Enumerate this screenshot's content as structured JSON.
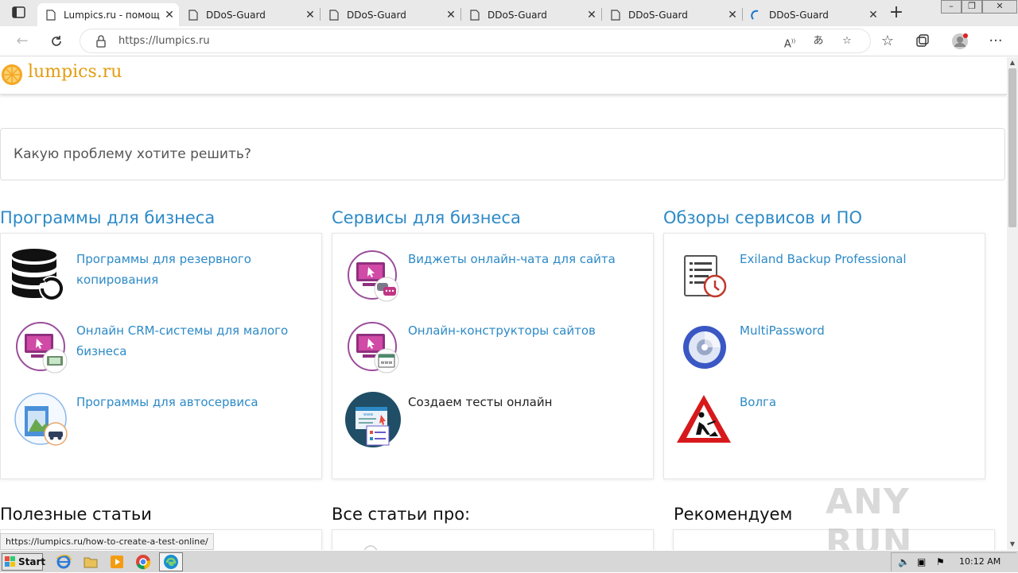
{
  "browser": {
    "tabs": [
      {
        "title": "Lumpics.ru - помощ",
        "active": true
      },
      {
        "title": "DDoS-Guard",
        "active": false
      },
      {
        "title": "DDoS-Guard",
        "active": false
      },
      {
        "title": "DDoS-Guard",
        "active": false
      },
      {
        "title": "DDoS-Guard",
        "active": false
      },
      {
        "title": "DDoS-Guard",
        "active": false,
        "loading": true
      }
    ],
    "url": "https://lumpics.ru",
    "status_url": "https://lumpics.ru/how-to-create-a-test-online/"
  },
  "site": {
    "logo_text": "lumpics.ru",
    "search_placeholder": "Какую проблему хотите решить?",
    "columns": [
      {
        "title": "Программы для бизнеса",
        "items": [
          {
            "label": "Программы для резервного копирования",
            "icon": "database-backup-icon"
          },
          {
            "label": "Онлайн CRM-системы для малого бизнеса",
            "icon": "crm-icon"
          },
          {
            "label": "Программы для автосервиса",
            "icon": "autoservice-icon"
          }
        ]
      },
      {
        "title": "Сервисы для бизнеса",
        "items": [
          {
            "label": "Виджеты онлайн-чата для сайта",
            "icon": "chat-widget-icon"
          },
          {
            "label": "Онлайн-конструкторы сайтов",
            "icon": "site-builder-icon"
          },
          {
            "label": "Создаем тесты онлайн",
            "icon": "online-test-icon"
          }
        ]
      },
      {
        "title": "Обзоры сервисов и ПО",
        "items": [
          {
            "label": "Exiland Backup Professional",
            "icon": "exiland-icon"
          },
          {
            "label": "MultiPassword",
            "icon": "multipassword-icon"
          },
          {
            "label": "Волга",
            "icon": "road-works-icon"
          }
        ]
      }
    ],
    "sections": {
      "useful": "Полезные статьи",
      "all_articles": "Все статьи про:",
      "recommend": "Рекомендуем"
    }
  },
  "watermark": "ANY RUN",
  "taskbar": {
    "start_label": "Start",
    "clock": "10:12 AM"
  },
  "colors": {
    "link": "#2d8ac7",
    "logo": "#e49b0f"
  }
}
